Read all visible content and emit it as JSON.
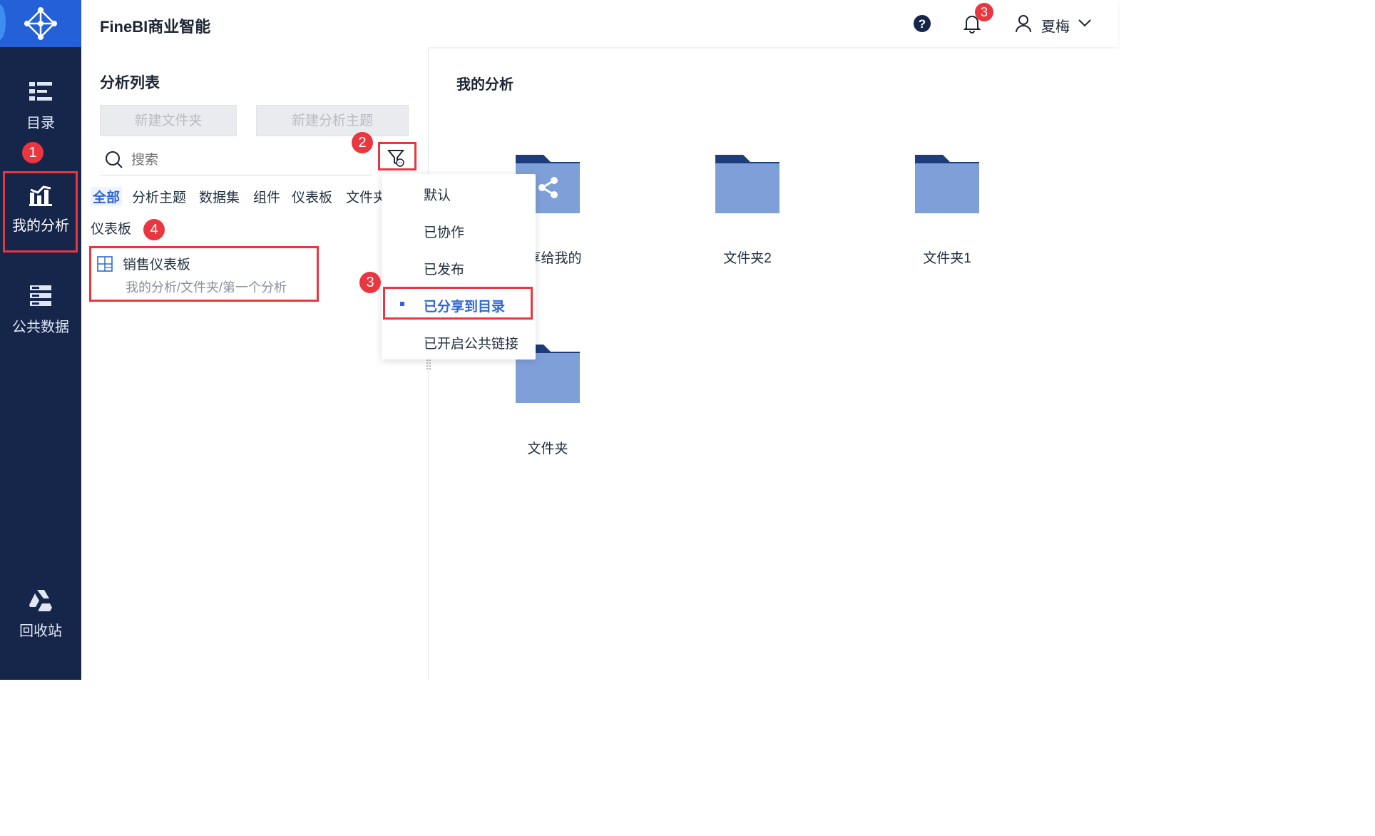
{
  "app": {
    "title": "FineBI商业智能"
  },
  "user": {
    "name": "夏梅",
    "notification_count": "3"
  },
  "sidebar": {
    "items": [
      {
        "label": "目录",
        "icon": "catalog-icon"
      },
      {
        "label": "我的分析",
        "icon": "analysis-icon"
      },
      {
        "label": "公共数据",
        "icon": "database-icon"
      },
      {
        "label": "回收站",
        "icon": "recycle-icon"
      }
    ]
  },
  "left": {
    "title": "分析列表",
    "new_folder": "新建文件夹",
    "new_subject": "新建分析主题",
    "search_placeholder": "搜索",
    "tabs": [
      "全部",
      "分析主题",
      "数据集",
      "组件",
      "仪表板",
      "文件夹"
    ],
    "section": "仪表板",
    "result": {
      "name": "销售仪表板",
      "path": "我的分析/文件夹/第一个分析"
    }
  },
  "filter_menu": {
    "items": [
      "默认",
      "已协作",
      "已发布",
      "已分享到目录",
      "已开启公共链接"
    ],
    "selected": "已分享到目录"
  },
  "right": {
    "title": "我的分析",
    "folders": [
      "共享给我的",
      "文件夹2",
      "文件夹1",
      "文件夹"
    ]
  },
  "annotations": [
    "1",
    "2",
    "3",
    "4"
  ],
  "colors": {
    "accent": "#2f66d6",
    "sidebar": "#16254a",
    "folder": "#7f9fd9",
    "folder_tab": "#1c3c7c",
    "highlight": "#e8373f"
  }
}
